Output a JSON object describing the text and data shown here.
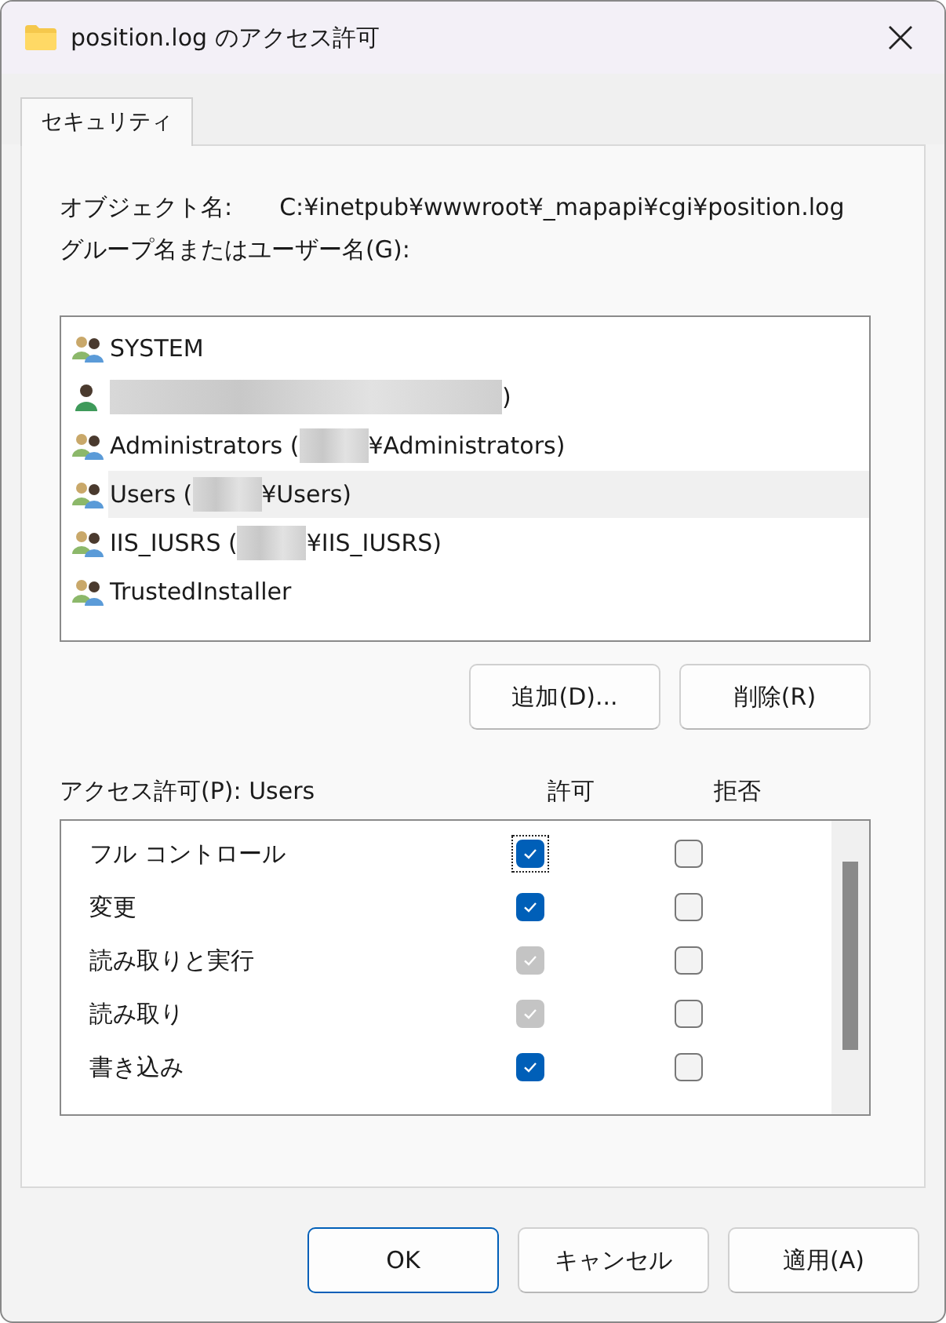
{
  "window": {
    "title": "position.log のアクセス許可"
  },
  "tabs": [
    {
      "label": "セキュリティ",
      "selected": true
    }
  ],
  "object_name": {
    "label": "オブジェクト名:",
    "value": "C:¥inetpub¥wwwroot¥_mapapi¥cgi¥position.log"
  },
  "groups_label": "グループ名またはユーザー名(G):",
  "groups": [
    {
      "kind": "group",
      "before": "SYSTEM",
      "redacted": false,
      "selected": false
    },
    {
      "kind": "user",
      "redacted": true,
      "after": ")",
      "selected": false
    },
    {
      "kind": "group",
      "before": "Administrators (",
      "redacted": true,
      "after": "¥Administrators)",
      "selected": false
    },
    {
      "kind": "group",
      "before": "Users (",
      "redacted": true,
      "after": "¥Users)",
      "selected": true
    },
    {
      "kind": "group",
      "before": "IIS_IUSRS (",
      "redacted": true,
      "after": "¥IIS_IUSRS)",
      "selected": false
    },
    {
      "kind": "group",
      "before": "TrustedInstaller",
      "redacted": false,
      "selected": false
    }
  ],
  "group_buttons": [
    "追加(D)...",
    "削除(R)"
  ],
  "permissions_header": {
    "label": "アクセス許可(P): Users",
    "allow": "許可",
    "deny": "拒否"
  },
  "permissions": [
    {
      "name": "フル コントロール",
      "allow": {
        "checked": true,
        "disabled": false,
        "focused": true
      },
      "deny": {
        "checked": false,
        "disabled": false
      }
    },
    {
      "name": "変更",
      "allow": {
        "checked": true,
        "disabled": false,
        "focused": false
      },
      "deny": {
        "checked": false,
        "disabled": false
      }
    },
    {
      "name": "読み取りと実行",
      "allow": {
        "checked": true,
        "disabled": true,
        "focused": false
      },
      "deny": {
        "checked": false,
        "disabled": false
      }
    },
    {
      "name": "読み取り",
      "allow": {
        "checked": true,
        "disabled": true,
        "focused": false
      },
      "deny": {
        "checked": false,
        "disabled": false
      }
    },
    {
      "name": "書き込み",
      "allow": {
        "checked": true,
        "disabled": false,
        "focused": false
      },
      "deny": {
        "checked": false,
        "disabled": false
      }
    }
  ],
  "footer_buttons": [
    {
      "label": "OK",
      "primary": true
    },
    {
      "label": "キャンセル",
      "primary": false
    },
    {
      "label": "適用(A)",
      "primary": false
    }
  ]
}
